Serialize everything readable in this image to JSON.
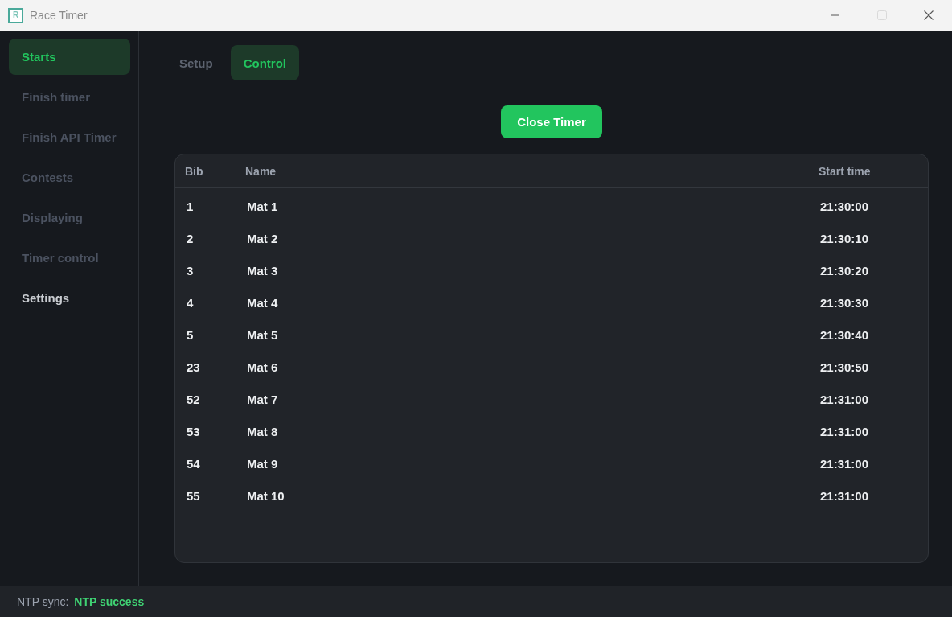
{
  "window": {
    "title": "Race Timer",
    "app_icon_letter": "R",
    "controls": [
      {
        "kind": "minimize",
        "disabled": false
      },
      {
        "kind": "maximize",
        "disabled": true
      },
      {
        "kind": "close",
        "disabled": false
      }
    ]
  },
  "sidebar": {
    "items": [
      {
        "label": "Starts",
        "selected": true,
        "disabled": false
      },
      {
        "label": "Finish timer",
        "selected": false,
        "disabled": true
      },
      {
        "label": "Finish API Timer",
        "selected": false,
        "disabled": true
      },
      {
        "label": "Contests",
        "selected": false,
        "disabled": true
      },
      {
        "label": "Displaying",
        "selected": false,
        "disabled": true
      },
      {
        "label": "Timer control",
        "selected": false,
        "disabled": true
      },
      {
        "label": "Settings",
        "selected": false,
        "disabled": false
      }
    ]
  },
  "tabs": [
    {
      "label": "Setup",
      "selected": false
    },
    {
      "label": "Control",
      "selected": true
    }
  ],
  "primary_button": {
    "label": "Close Timer"
  },
  "table": {
    "columns": [
      "Bib",
      "Name",
      "Start time"
    ],
    "rows": [
      {
        "bib": "1",
        "name": "Mat 1",
        "start_time": "21:30:00"
      },
      {
        "bib": "2",
        "name": "Mat 2",
        "start_time": "21:30:10"
      },
      {
        "bib": "3",
        "name": "Mat 3",
        "start_time": "21:30:20"
      },
      {
        "bib": "4",
        "name": "Mat 4",
        "start_time": "21:30:30"
      },
      {
        "bib": "5",
        "name": "Mat 5",
        "start_time": "21:30:40"
      },
      {
        "bib": "23",
        "name": "Mat 6",
        "start_time": "21:30:50"
      },
      {
        "bib": "52",
        "name": "Mat 7",
        "start_time": "21:31:00"
      },
      {
        "bib": "53",
        "name": "Mat 8",
        "start_time": "21:31:00"
      },
      {
        "bib": "54",
        "name": "Mat 9",
        "start_time": "21:31:00"
      },
      {
        "bib": "55",
        "name": "Mat 10",
        "start_time": "21:31:00"
      }
    ]
  },
  "status_bar": {
    "label": "NTP sync:",
    "value": "NTP success"
  }
}
